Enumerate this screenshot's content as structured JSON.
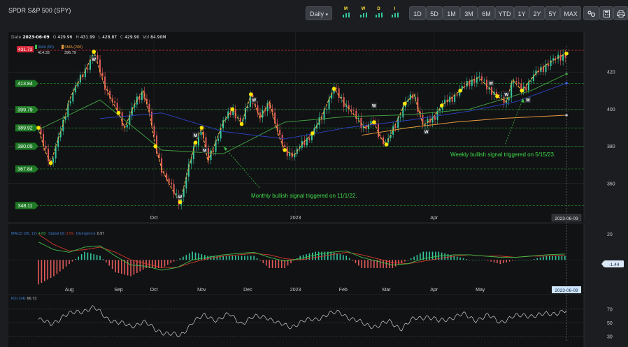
{
  "header": {
    "title": "SPDR S&P 500 (SPY)",
    "interval_label": "Daily",
    "signal_toggles": [
      "M",
      "W",
      "D",
      "I"
    ],
    "ranges": [
      "1D",
      "5D",
      "1M",
      "3M",
      "6M",
      "YTD",
      "1Y",
      "2Y",
      "5Y",
      "MAX"
    ],
    "active_range": "1Y"
  },
  "ohlc": {
    "date_label": "Date",
    "date": "2023-06-09",
    "o_label": "O",
    "o": "429.96",
    "h_label": "H",
    "h": "431.99",
    "l_label": "L",
    "l": "428.87",
    "c_label": "C",
    "c": "429.90",
    "vol_label": "Vol",
    "vol": "84.90M"
  },
  "legend": {
    "price": "431.73",
    "sma50_name": "SMA (50)",
    "sma50_value": "414.33",
    "sma200_name": "SMA (200)",
    "sma200_value": "396.79"
  },
  "colors": {
    "up": "#37c9a0",
    "down": "#e25b5b",
    "sma50": "#3f9a3f",
    "sma200": "#e89a3c",
    "blue_ma": "#2a3fb8",
    "zigzag": "#f2a43a",
    "pivot": "#ffe600",
    "level": "#1f8a2a",
    "macd_line": "#3fbf4a",
    "signal_line": "#d23b2b",
    "rsi": "#d0d0d0",
    "price_tag": "#d8283a"
  },
  "levels": [
    {
      "label": "413.84",
      "value": 413.84
    },
    {
      "label": "399.79",
      "value": 399.79
    },
    {
      "label": "389.92",
      "value": 389.92
    },
    {
      "label": "380.05",
      "value": 380.05
    },
    {
      "label": "367.84",
      "value": 367.84
    },
    {
      "label": "348.11",
      "value": 348.11
    }
  ],
  "annotations": {
    "monthly": "Monthly bullish signal triggered on 11/1/22.",
    "weekly": "Weekly bullish signal triggered on 5/15/23."
  },
  "macd": {
    "title": "MACD (26, 12)",
    "macd_value": "4.65",
    "signal_label": "Signal (9)",
    "signal_value": "3.69",
    "divergence_label": "Divergence",
    "divergence_value": "0.97",
    "tag": "1.44"
  },
  "rsi": {
    "title": "RSI (14)",
    "value": "66.73"
  },
  "cursor_date": "2023-06-09",
  "chart_data": [
    {
      "type": "candlestick",
      "title": "SPDR S&P 500 (SPY)",
      "ylim": [
        343,
        434
      ],
      "yticks": [
        360,
        380,
        400,
        420
      ],
      "x_tick_labels": [
        {
          "label": "Oct",
          "day": 75
        },
        {
          "label": "2023",
          "day": 167
        },
        {
          "label": "Apr",
          "day": 257
        }
      ],
      "x_range_days": [
        0,
        345
      ],
      "series": [
        {
          "name": "SPY close (zigzag pivots)",
          "x_days": [
            0,
            4,
            8,
            12,
            16,
            20,
            24,
            30,
            36,
            42,
            48,
            52,
            56,
            62,
            68,
            72,
            76,
            80,
            86,
            92,
            98,
            102,
            106,
            110,
            114,
            120,
            126,
            132,
            138,
            144,
            150,
            156,
            160,
            166,
            172,
            178,
            184,
            188,
            192,
            200,
            206,
            212,
            218,
            222,
            226,
            232,
            238,
            244,
            250,
            256,
            262,
            268,
            274,
            280,
            286,
            292,
            298,
            304,
            308,
            314,
            318,
            324,
            330,
            338,
            343
          ],
          "close": [
            390,
            378,
            371,
            382,
            392,
            405,
            412,
            420,
            431,
            415,
            404,
            398,
            390,
            402,
            410,
            398,
            380,
            368,
            358,
            350,
            370,
            382,
            390,
            372,
            380,
            393,
            400,
            392,
            408,
            395,
            404,
            386,
            378,
            375,
            382,
            387,
            396,
            404,
            411,
            402,
            396,
            390,
            393,
            385,
            381,
            392,
            403,
            408,
            391,
            395,
            402,
            406,
            410,
            415,
            417,
            412,
            407,
            404,
            416,
            410,
            414,
            420,
            424,
            428,
            430
          ]
        },
        {
          "name": "SMA (50)",
          "x_days": [
            0,
            40,
            80,
            120,
            160,
            200,
            240,
            280,
            300,
            320,
            343
          ],
          "values": [
            389,
            405,
            378,
            376,
            393,
            396,
            397,
            400,
            405,
            410,
            419
          ]
        },
        {
          "name": "SMA (200)",
          "x_days": [
            210,
            240,
            270,
            300,
            343
          ],
          "values": [
            386,
            390,
            393,
            395,
            396.79
          ]
        },
        {
          "name": "Moving average (blue)",
          "x_days": [
            40,
            80,
            120,
            160,
            200,
            240,
            280,
            310,
            343
          ],
          "values": [
            395,
            398,
            388,
            384,
            390,
            394,
            399,
            404,
            414
          ]
        }
      ]
    },
    {
      "type": "line",
      "title": "MACD (26, 12)",
      "ylim": [
        -25,
        22
      ],
      "yticks": [
        20
      ],
      "x_tick_labels": [
        {
          "label": "Aug",
          "day": 20
        },
        {
          "label": "Sep",
          "day": 52
        },
        {
          "label": "Oct",
          "day": 75
        },
        {
          "label": "Nov",
          "day": 106
        },
        {
          "label": "Dec",
          "day": 136
        },
        {
          "label": "2023",
          "day": 167
        },
        {
          "label": "Feb",
          "day": 198
        },
        {
          "label": "Mar",
          "day": 226
        },
        {
          "label": "Apr",
          "day": 257
        },
        {
          "label": "May",
          "day": 287
        }
      ],
      "series": [
        {
          "name": "MACD",
          "x_days": [
            0,
            10,
            20,
            30,
            40,
            50,
            60,
            70,
            80,
            90,
            100,
            110,
            120,
            130,
            140,
            150,
            160,
            170,
            180,
            190,
            200,
            210,
            220,
            230,
            240,
            250,
            260,
            270,
            280,
            290,
            300,
            310,
            320,
            330,
            343
          ],
          "values": [
            14,
            8,
            6,
            10,
            11,
            3,
            -4,
            -5,
            -8,
            -6,
            0,
            2,
            4,
            5,
            6,
            2,
            -1,
            1,
            4,
            6,
            7,
            2,
            -1,
            -4,
            -3,
            1,
            3,
            4,
            4,
            3,
            2,
            2,
            3,
            4,
            4.65
          ]
        },
        {
          "name": "Signal (9)",
          "x_days": [
            0,
            10,
            20,
            30,
            40,
            50,
            60,
            70,
            80,
            90,
            100,
            110,
            120,
            130,
            140,
            150,
            160,
            170,
            180,
            190,
            200,
            210,
            220,
            230,
            240,
            250,
            260,
            270,
            280,
            290,
            300,
            310,
            320,
            330,
            343
          ],
          "values": [
            20,
            12,
            7,
            8,
            10,
            6,
            0,
            -3,
            -6,
            -6,
            -2,
            1,
            3,
            4,
            5,
            4,
            1,
            0,
            2,
            4,
            6,
            4,
            1,
            -2,
            -3,
            -1,
            1,
            3,
            4,
            3,
            3,
            2,
            3,
            3,
            3.69
          ]
        }
      ]
    },
    {
      "type": "line",
      "title": "RSI (14)",
      "ylim": [
        22,
        78
      ],
      "yticks": [
        30,
        50,
        70
      ],
      "series": [
        {
          "name": "RSI (14)",
          "x_days": [
            0,
            8,
            16,
            24,
            32,
            36,
            44,
            52,
            60,
            68,
            76,
            84,
            92,
            100,
            108,
            116,
            124,
            132,
            140,
            148,
            156,
            164,
            172,
            180,
            188,
            196,
            204,
            212,
            220,
            228,
            236,
            244,
            252,
            260,
            268,
            276,
            284,
            292,
            300,
            308,
            316,
            324,
            332,
            343
          ],
          "values": [
            55,
            48,
            60,
            65,
            70,
            72,
            58,
            50,
            45,
            52,
            40,
            35,
            30,
            52,
            60,
            55,
            62,
            50,
            58,
            60,
            48,
            45,
            52,
            56,
            62,
            66,
            55,
            48,
            45,
            52,
            42,
            56,
            60,
            52,
            58,
            62,
            55,
            60,
            52,
            58,
            62,
            60,
            64,
            66.73
          ]
        }
      ]
    }
  ]
}
